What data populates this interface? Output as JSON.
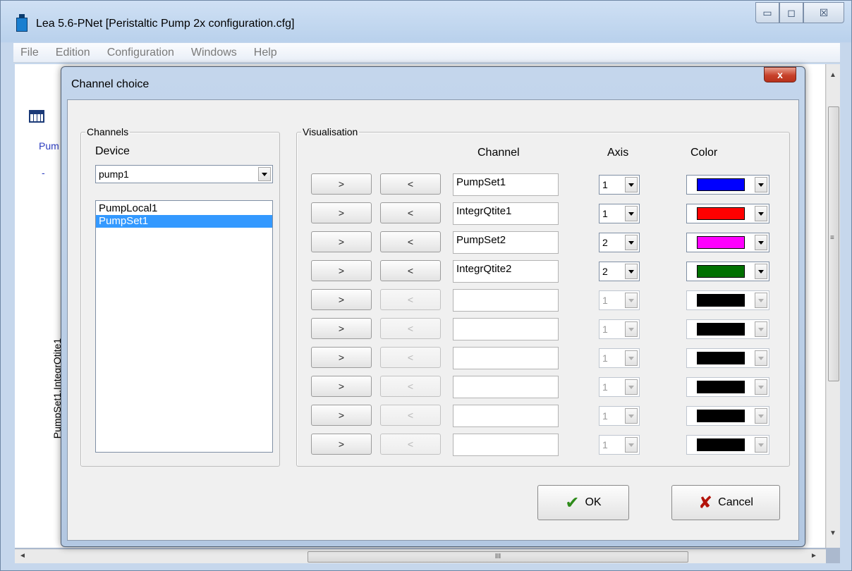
{
  "window": {
    "title": "Lea 5.6-PNet [Peristaltic Pump 2x configuration.cfg]",
    "minimize": "▭",
    "maximize": "◻",
    "close": "☒"
  },
  "menubar": [
    "File",
    "Edition",
    "Configuration",
    "Windows",
    "Help"
  ],
  "mdi": {
    "link_text": "Pum",
    "dash": "-",
    "vertical_label": "PumpSet1,IntegrQtite1",
    "scroll_grip": "≡",
    "hscroll_grip": "III",
    "up_arrow": "▲",
    "down_arrow": "▼",
    "left_arrow": "◄",
    "right_arrow": "►"
  },
  "dialog": {
    "title": "Channel choice",
    "close": "x",
    "channels_group": {
      "legend": "Channels",
      "device_label": "Device",
      "device_value": "pump1",
      "list": [
        {
          "label": "PumpLocal1",
          "selected": false
        },
        {
          "label": "PumpSet1",
          "selected": true
        }
      ]
    },
    "visual_group": {
      "legend": "Visualisation",
      "headers": {
        "channel": "Channel",
        "axis": "Axis",
        "color": "Color"
      },
      "add_label": ">",
      "remove_label": "<",
      "rows": [
        {
          "channel": "PumpSet1",
          "axis": "1",
          "color": "#0000ff",
          "enabled": true
        },
        {
          "channel": "IntegrQtite1",
          "axis": "1",
          "color": "#ff0000",
          "enabled": true
        },
        {
          "channel": "PumpSet2",
          "axis": "2",
          "color": "#ff00ff",
          "enabled": true
        },
        {
          "channel": "IntegrQtite2",
          "axis": "2",
          "color": "#007000",
          "enabled": true
        },
        {
          "channel": "",
          "axis": "1",
          "color": "#000000",
          "enabled": false
        },
        {
          "channel": "",
          "axis": "1",
          "color": "#000000",
          "enabled": false
        },
        {
          "channel": "",
          "axis": "1",
          "color": "#000000",
          "enabled": false
        },
        {
          "channel": "",
          "axis": "1",
          "color": "#000000",
          "enabled": false
        },
        {
          "channel": "",
          "axis": "1",
          "color": "#000000",
          "enabled": false
        },
        {
          "channel": "",
          "axis": "1",
          "color": "#000000",
          "enabled": false
        }
      ]
    },
    "ok_label": "OK",
    "cancel_label": "Cancel",
    "ok_icon": "✔",
    "cancel_icon": "✘"
  }
}
